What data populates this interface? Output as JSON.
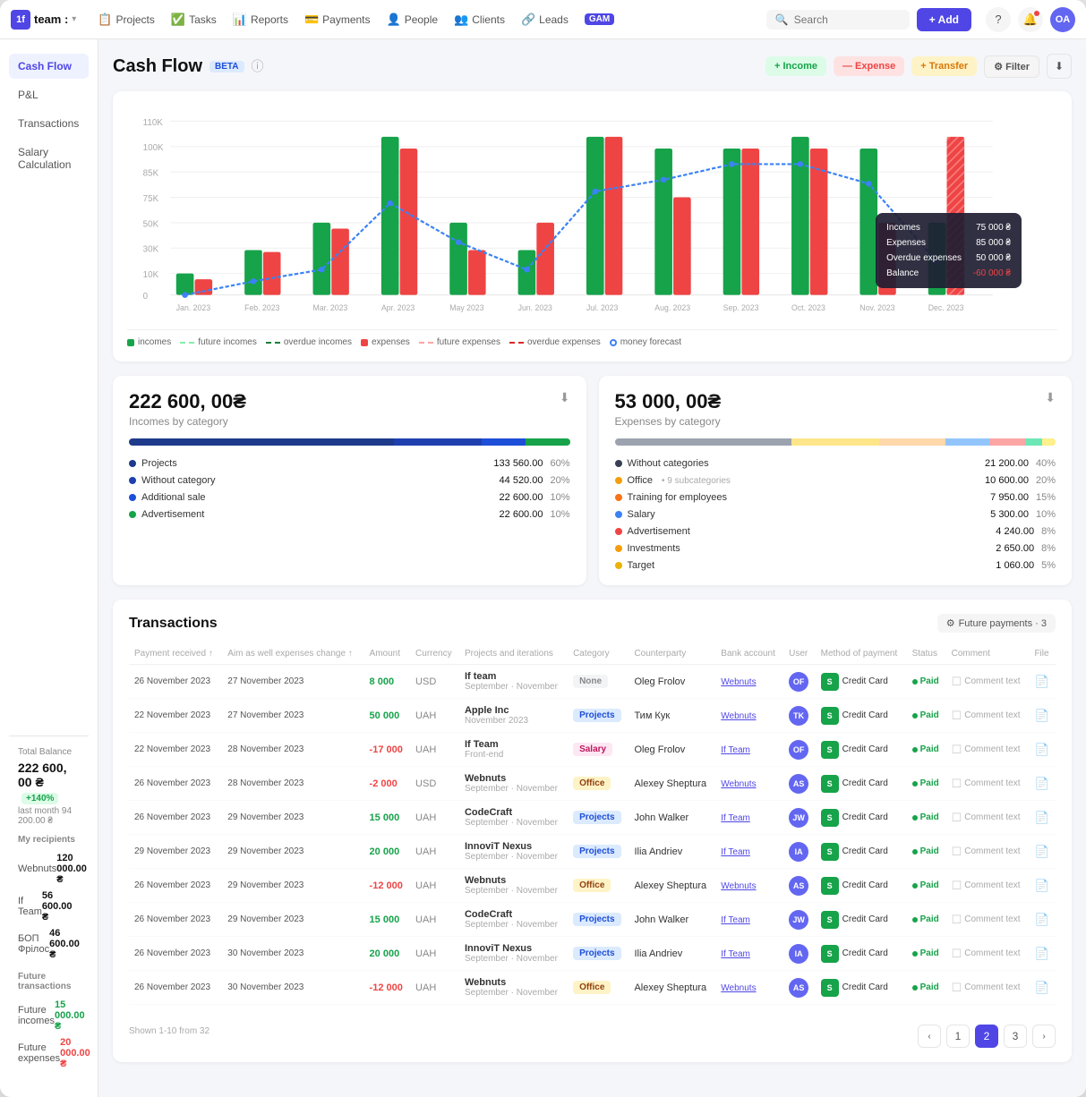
{
  "nav": {
    "logo": "1f",
    "team_name": "team :",
    "items": [
      {
        "label": "Projects",
        "icon": "📋"
      },
      {
        "label": "Tasks",
        "icon": "✅"
      },
      {
        "label": "Reports",
        "icon": "📊"
      },
      {
        "label": "Payments",
        "icon": "💳"
      },
      {
        "label": "People",
        "icon": "👤"
      },
      {
        "label": "Clients",
        "icon": "👥"
      },
      {
        "label": "Leads",
        "icon": "🔗"
      },
      {
        "label": "GAM",
        "badge": true
      }
    ],
    "search_placeholder": "Search",
    "add_btn": "+ Add",
    "avatar_initials": "OA"
  },
  "sidebar": {
    "items": [
      {
        "label": "Cash Flow",
        "active": true
      },
      {
        "label": "P&L"
      },
      {
        "label": "Transactions"
      },
      {
        "label": "Salary Calculation"
      }
    ],
    "total_balance_label": "Total Balance",
    "total_balance_amount": "222 600, 00 ₴",
    "balance_change": "+140%",
    "last_month": "last month  94 200.00 ₴",
    "recipients_label": "My recipients",
    "recipients": [
      {
        "name": "Webnuts",
        "amount": "120 000.00 ₴"
      },
      {
        "name": "If Team",
        "amount": "56 600.00 ₴"
      },
      {
        "name": "БОП Фрілос",
        "amount": "46 600.00 ₴"
      }
    ],
    "future_label": "Future transactions",
    "future": [
      {
        "name": "Future incomes",
        "amount": "15 000.00 ₴",
        "type": "income"
      },
      {
        "name": "Future expenses",
        "amount": "20 000.00 ₴",
        "type": "expense"
      }
    ]
  },
  "page": {
    "title": "Cash Flow",
    "beta": "BETA",
    "actions": {
      "income": "+ Income",
      "expense": "— Expense",
      "transfer": "+ Transfer",
      "filter": "Filter",
      "download": "⬇"
    }
  },
  "chart": {
    "months": [
      "Jan. 2023",
      "Feb. 2023",
      "Mar. 2023",
      "Apr. 2023",
      "May 2023",
      "Jun. 2023",
      "Jul. 2023",
      "Aug. 2023",
      "Sep. 2023",
      "Oct. 2023",
      "Nov. 2023",
      "Dec. 2023"
    ],
    "tooltip": {
      "incomes_label": "Incomes",
      "incomes_value": "75 000 ₴",
      "expenses_label": "Expenses",
      "expenses_value": "85 000 ₴",
      "overdue_label": "Overdue expenses",
      "overdue_value": "50 000 ₴",
      "balance_label": "Balance",
      "balance_value": "-60 000 ₴"
    },
    "legend": [
      {
        "label": "incomes",
        "type": "box",
        "color": "#16a34a"
      },
      {
        "label": "future incomes",
        "type": "dash",
        "color": "#86efac"
      },
      {
        "label": "overdue incomes",
        "type": "dash",
        "color": "#15803d"
      },
      {
        "label": "expenses",
        "type": "box",
        "color": "#ef4444"
      },
      {
        "label": "future expenses",
        "type": "dash",
        "color": "#fca5a5"
      },
      {
        "label": "overdue expenses",
        "type": "dash",
        "color": "#dc2626"
      },
      {
        "label": "money forecast",
        "type": "circle",
        "color": "#3b82f6"
      }
    ]
  },
  "income_summary": {
    "amount": "222 600, 00₴",
    "label": "Incomes by category",
    "categories": [
      {
        "name": "Projects",
        "amount": "133 560.00",
        "pct": "60%",
        "color": "#1e3a8a"
      },
      {
        "name": "Without category",
        "amount": "44 520.00",
        "pct": "20%",
        "color": "#1e40af"
      },
      {
        "name": "Additional sale",
        "amount": "22 600.00",
        "pct": "10%",
        "color": "#1d4ed8"
      },
      {
        "name": "Advertisement",
        "amount": "22 600.00",
        "pct": "10%",
        "color": "#16a34a"
      }
    ],
    "bar_segments": [
      {
        "color": "#1e3a8a",
        "pct": 60
      },
      {
        "color": "#1e40af",
        "pct": 20
      },
      {
        "color": "#1d4ed8",
        "pct": 10
      },
      {
        "color": "#16a34a",
        "pct": 10
      }
    ]
  },
  "expense_summary": {
    "amount": "53 000, 00₴",
    "label": "Expenses by category",
    "categories": [
      {
        "name": "Without categories",
        "amount": "21 200.00",
        "pct": "40%",
        "color": "#374151",
        "sub": ""
      },
      {
        "name": "Office",
        "amount": "10 600.00",
        "pct": "20%",
        "color": "#f59e0b",
        "sub": "• 9 subcategories"
      },
      {
        "name": "Training for employees",
        "amount": "7 950.00",
        "pct": "15%",
        "color": "#f97316",
        "sub": ""
      },
      {
        "name": "Salary",
        "amount": "5 300.00",
        "pct": "10%",
        "color": "#3b82f6",
        "sub": ""
      },
      {
        "name": "Advertisement",
        "amount": "4 240.00",
        "pct": "8%",
        "color": "#ef4444",
        "sub": ""
      },
      {
        "name": "Investments",
        "amount": "2 650.00",
        "pct": "8%",
        "color": "#f59e0b",
        "sub": ""
      },
      {
        "name": "Target",
        "amount": "1 060.00",
        "pct": "5%",
        "color": "#eab308",
        "sub": ""
      }
    ],
    "bar_segments": [
      {
        "color": "#9ca3af",
        "pct": 40
      },
      {
        "color": "#fde68a",
        "pct": 20
      },
      {
        "color": "#fed7aa",
        "pct": 15
      },
      {
        "color": "#93c5fd",
        "pct": 10
      },
      {
        "color": "#fca5a5",
        "pct": 8
      },
      {
        "color": "#6ee7b7",
        "pct": 4
      },
      {
        "color": "#fde68a",
        "pct": 3
      }
    ]
  },
  "transactions": {
    "title": "Transactions",
    "future_payments": "Future payments · 3",
    "shown_label": "Shown 1-10 from 32",
    "columns": [
      "Payment received",
      "Aim as well expenses change",
      "Amount",
      "Currency",
      "Projects and iterations",
      "Category",
      "Counterparty",
      "Bank account",
      "User",
      "Method of payment",
      "Status",
      "Comment",
      "File"
    ],
    "rows": [
      {
        "date1": "26 November 2023",
        "date2": "27 November 2023",
        "amount": "8 000",
        "amount_sign": "positive",
        "currency": "USD",
        "project": "If team\nSeptember · November",
        "category": "None",
        "category_type": "none",
        "counterparty": "Oleg Frolov",
        "bank": "Webnuts",
        "user_initials": "OF",
        "method": "Credit Card",
        "status": "Paid",
        "comment": "Comment text"
      },
      {
        "date1": "22 November 2023",
        "date2": "27 November 2023",
        "amount": "50 000",
        "amount_sign": "positive",
        "currency": "UAH",
        "project": "Apple Inc\nNovember 2023",
        "category": "Projects",
        "category_type": "projects",
        "counterparty": "Тим Кук",
        "bank": "Webnuts",
        "user_initials": "TK",
        "method": "Credit Card",
        "status": "Paid",
        "comment": "Comment text"
      },
      {
        "date1": "22 November 2023",
        "date2": "28 November 2023",
        "amount": "-17 000",
        "amount_sign": "negative",
        "currency": "UAH",
        "project": "If Team\nFront-end",
        "category": "Salary",
        "category_type": "salary",
        "counterparty": "Oleg Frolov",
        "bank": "If Team",
        "user_initials": "OF",
        "method": "Credit Card",
        "status": "Paid",
        "comment": "Comment text"
      },
      {
        "date1": "26 November 2023",
        "date2": "28 November 2023",
        "amount": "-2 000",
        "amount_sign": "negative",
        "currency": "USD",
        "project": "Webnuts\nSeptember · November",
        "category": "Office",
        "category_type": "office",
        "counterparty": "Alexey Sheptura",
        "bank": "Webnuts",
        "user_initials": "AS",
        "method": "Credit Card",
        "status": "Paid",
        "comment": "Comment text"
      },
      {
        "date1": "26 November 2023",
        "date2": "29 November 2023",
        "amount": "15 000",
        "amount_sign": "positive",
        "currency": "UAH",
        "project": "CodeCraft\nSeptember · November",
        "category": "Projects",
        "category_type": "projects",
        "counterparty": "John Walker",
        "bank": "If Team",
        "user_initials": "JW",
        "method": "Credit Card",
        "status": "Paid",
        "comment": "Comment text"
      },
      {
        "date1": "29 November 2023",
        "date2": "29 November 2023",
        "amount": "20 000",
        "amount_sign": "positive",
        "currency": "UAH",
        "project": "InnoviT Nexus\nSeptember · November",
        "category": "Projects",
        "category_type": "projects",
        "counterparty": "Ilia Andriev",
        "bank": "If Team",
        "user_initials": "IA",
        "method": "Credit Card",
        "status": "Paid",
        "comment": "Comment text"
      },
      {
        "date1": "26 November 2023",
        "date2": "29 November 2023",
        "amount": "-12 000",
        "amount_sign": "negative",
        "currency": "UAH",
        "project": "Webnuts\nSeptember · November",
        "category": "Office",
        "category_type": "office",
        "counterparty": "Alexey Sheptura",
        "bank": "Webnuts",
        "user_initials": "AS",
        "method": "Credit Card",
        "status": "Paid",
        "comment": "Comment text"
      },
      {
        "date1": "26 November 2023",
        "date2": "29 November 2023",
        "amount": "15 000",
        "amount_sign": "positive",
        "currency": "UAH",
        "project": "CodeCraft\nSeptember · November",
        "category": "Projects",
        "category_type": "projects",
        "counterparty": "John Walker",
        "bank": "If Team",
        "user_initials": "JW",
        "method": "Credit Card",
        "status": "Paid",
        "comment": "Comment text"
      },
      {
        "date1": "26 November 2023",
        "date2": "30 November 2023",
        "amount": "20 000",
        "amount_sign": "positive",
        "currency": "UAH",
        "project": "InnoviT Nexus\nSeptember · November",
        "category": "Projects",
        "category_type": "projects",
        "counterparty": "Ilia Andriev",
        "bank": "If Team",
        "user_initials": "IA",
        "method": "Credit Card",
        "status": "Paid",
        "comment": "Comment text"
      },
      {
        "date1": "26 November 2023",
        "date2": "30 November 2023",
        "amount": "-12 000",
        "amount_sign": "negative",
        "currency": "UAH",
        "project": "Webnuts\nSeptember · November",
        "category": "Office",
        "category_type": "office",
        "counterparty": "Alexey Sheptura",
        "bank": "Webnuts",
        "user_initials": "AS",
        "method": "Credit Card",
        "status": "Paid",
        "comment": "Comment text"
      }
    ],
    "pagination": [
      "‹",
      "1",
      "2",
      "3",
      "›"
    ]
  }
}
